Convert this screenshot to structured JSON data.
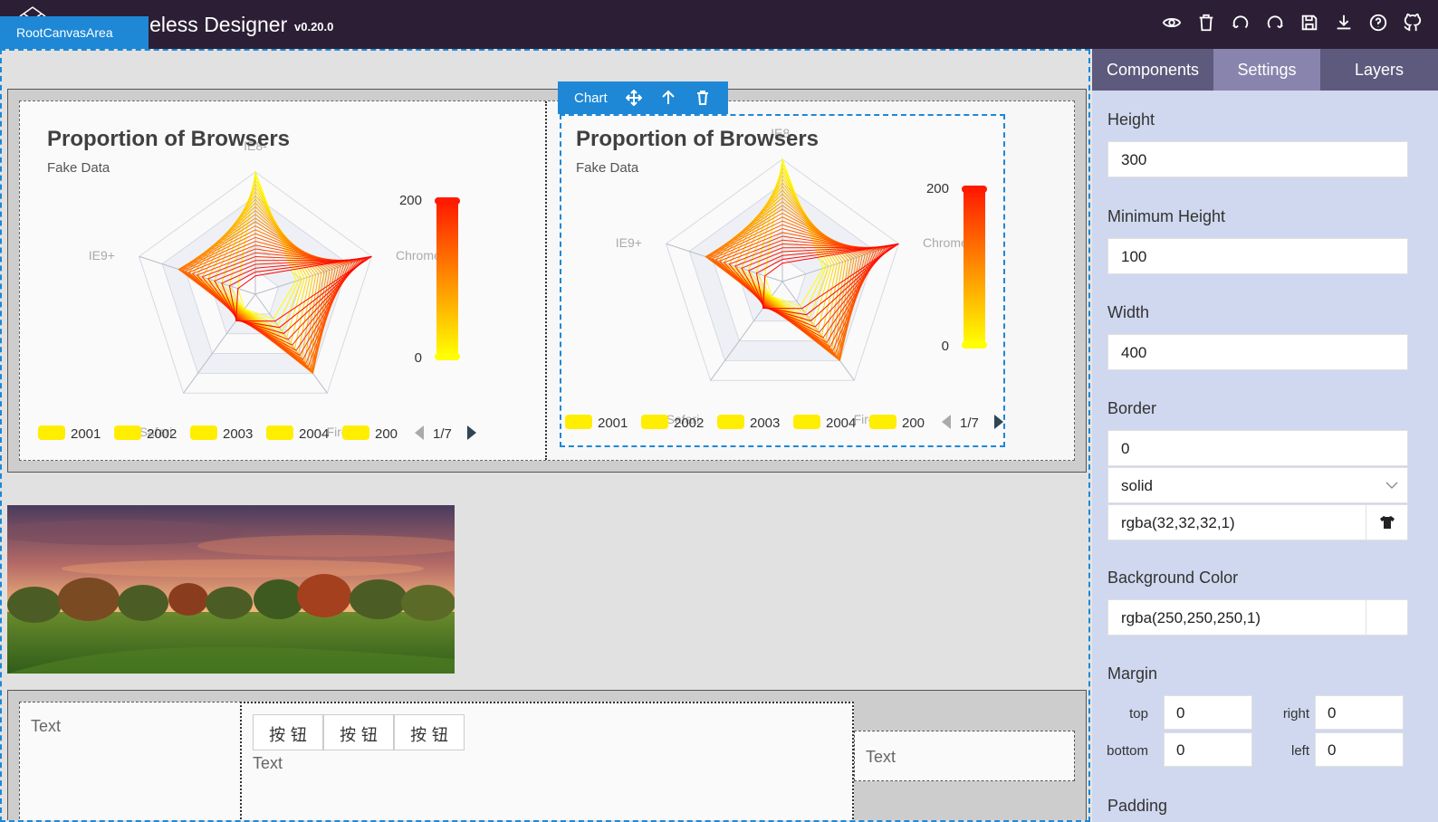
{
  "app": {
    "title": "leless Designer",
    "version": "v0.20.0",
    "root_label": "RootCanvasArea"
  },
  "toolbar_icons": [
    "eye-icon",
    "trash-icon",
    "undo-icon",
    "redo-icon",
    "save-icon",
    "download-icon",
    "help-icon",
    "github-icon"
  ],
  "selection": {
    "label": "Chart"
  },
  "charts": [
    {
      "title": "Proportion of Browsers",
      "subtitle": "Fake Data",
      "indicators": [
        "IE8-",
        "Chrome",
        "Firefox",
        "Safari",
        "IE9+"
      ],
      "visual_map": {
        "max_label": "200",
        "min_label": "0"
      },
      "legend": [
        "2001",
        "2002",
        "2003",
        "2004",
        "200"
      ],
      "legend_page": "1/7"
    },
    {
      "title": "Proportion of Browsers",
      "subtitle": "Fake Data",
      "indicators": [
        "IE8-",
        "Chrome",
        "Firefox",
        "Safari",
        "IE9+"
      ],
      "visual_map": {
        "max_label": "200",
        "min_label": "0"
      },
      "legend": [
        "2001",
        "2002",
        "2003",
        "2004",
        "200"
      ],
      "legend_page": "1/7"
    }
  ],
  "row3": {
    "text1": "Text",
    "text2": "Text",
    "text3": "Text",
    "buttons": [
      "按 钮",
      "按 钮",
      "按 钮"
    ]
  },
  "panel": {
    "tabs": [
      "Components",
      "Settings",
      "Layers"
    ],
    "active_tab": "Settings",
    "height_label": "Height",
    "height_value": "300",
    "min_height_label": "Minimum Height",
    "min_height_value": "100",
    "width_label": "Width",
    "width_value": "400",
    "border_label": "Border",
    "border_width": "0",
    "border_style": "solid",
    "border_color": "rgba(32,32,32,1)",
    "bg_label": "Background Color",
    "bg_value": "rgba(250,250,250,1)",
    "margin_label": "Margin",
    "margin": {
      "top_label": "top",
      "top": "0",
      "right_label": "right",
      "right": "0",
      "bottom_label": "bottom",
      "bottom": "0",
      "left_label": "left",
      "left": "0"
    },
    "padding_label": "Padding"
  }
}
